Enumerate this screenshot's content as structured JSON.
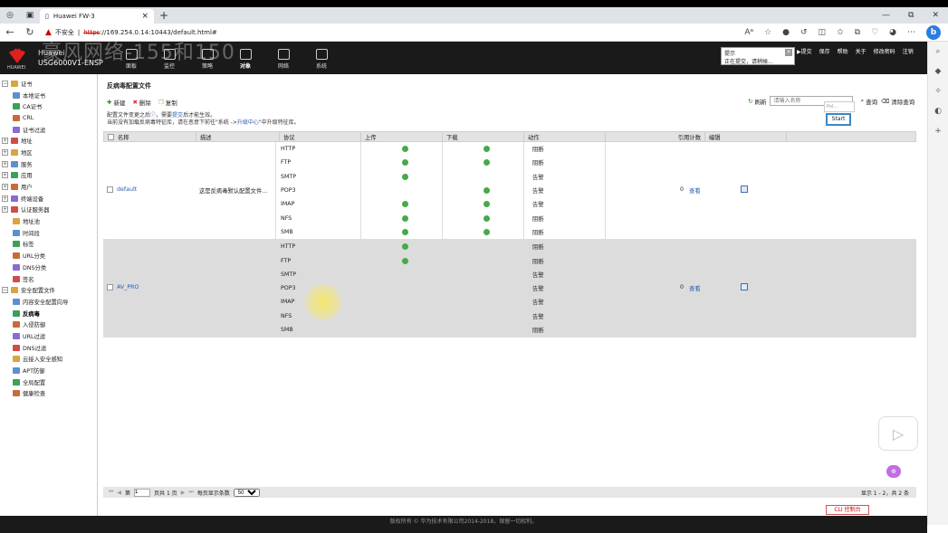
{
  "browser": {
    "tab_title": "Huawei FW-3",
    "insecure_label": "不安全",
    "url_https": "https",
    "url_rest": "://169.254.0.14:10443/default.html#"
  },
  "banner": {
    "brand_small": "HUAWEI",
    "vendor": "Huawei",
    "model": "USG6000V1-ENSP",
    "watermark": "豪风网络-155和150",
    "menu": [
      {
        "label": "面板"
      },
      {
        "label": "监控"
      },
      {
        "label": "策略"
      },
      {
        "label": "对象",
        "active": true
      },
      {
        "label": "网络"
      },
      {
        "label": "系统"
      }
    ],
    "tip_title": "提示",
    "tip_text": "正在提交，请稍候...",
    "links": [
      "▶提交",
      "保存",
      "帮助",
      "关于",
      "修改密码",
      "注销"
    ]
  },
  "sidebar": {
    "items": [
      {
        "label": "证书",
        "level": 0,
        "exp": "−"
      },
      {
        "label": "本地证书",
        "level": 1
      },
      {
        "label": "CA证书",
        "level": 1
      },
      {
        "label": "CRL",
        "level": 1
      },
      {
        "label": "证书过滤",
        "level": 1
      },
      {
        "label": "地址",
        "level": 0,
        "exp": "+"
      },
      {
        "label": "地区",
        "level": 0,
        "exp": "+"
      },
      {
        "label": "服务",
        "level": 0,
        "exp": "+"
      },
      {
        "label": "应用",
        "level": 0,
        "exp": "+"
      },
      {
        "label": "用户",
        "level": 0,
        "exp": "+"
      },
      {
        "label": "终端设备",
        "level": 0,
        "exp": "+"
      },
      {
        "label": "认证服务器",
        "level": 0,
        "exp": "+"
      },
      {
        "label": "地址池",
        "level": 1
      },
      {
        "label": "时间段",
        "level": 1
      },
      {
        "label": "标签",
        "level": 1
      },
      {
        "label": "URL分类",
        "level": 1
      },
      {
        "label": "DNS分类",
        "level": 1
      },
      {
        "label": "签名",
        "level": 1
      },
      {
        "label": "安全配置文件",
        "level": 0,
        "exp": "−"
      },
      {
        "label": "内容安全配置向导",
        "level": 1
      },
      {
        "label": "反病毒",
        "level": 1,
        "selected": true
      },
      {
        "label": "入侵防御",
        "level": 1
      },
      {
        "label": "URL过滤",
        "level": 1
      },
      {
        "label": "DNS过滤",
        "level": 1
      },
      {
        "label": "云接入安全感知",
        "level": 1
      },
      {
        "label": "APT防御",
        "level": 1
      },
      {
        "label": "全局配置",
        "level": 1
      },
      {
        "label": "健康检查",
        "level": 1
      }
    ]
  },
  "content": {
    "title": "反病毒配置文件",
    "toolbar": {
      "new": "新建",
      "delete": "删除",
      "copy": "复制"
    },
    "note_line1_a": "配置文件变更之后",
    "note_line1_b": "，需要",
    "note_line1_link": "提交",
    "note_line1_c": "后才能生效。",
    "note_line2_a": "当前没有加载反病毒特征库，请在恶意",
    "note_line2_b": "下前往\"系统 ->",
    "note_line2_link": "升级中心",
    "note_line2_c": "\"中升级特征库。",
    "refresh": "刷新",
    "search_placeholder": "请输入名称",
    "query": "查询",
    "clear_query": "清除查询",
    "dropdown_hint": "Pol...",
    "start": "Start",
    "columns": [
      "名称",
      "描述",
      "协议",
      "上传",
      "下载",
      "动作",
      "引用计数",
      "编辑"
    ],
    "profiles": [
      {
        "name": "default",
        "desc": "这是反病毒默认配置文件...",
        "refcount": "0",
        "view": "查看",
        "rows": [
          {
            "proto": "HTTP",
            "up": true,
            "down": true,
            "action": "阻断"
          },
          {
            "proto": "FTP",
            "up": true,
            "down": true,
            "action": "阻断"
          },
          {
            "proto": "SMTP",
            "up": true,
            "down": false,
            "action": "告警"
          },
          {
            "proto": "POP3",
            "up": false,
            "down": true,
            "action": "告警"
          },
          {
            "proto": "IMAP",
            "up": true,
            "down": true,
            "action": "告警"
          },
          {
            "proto": "NFS",
            "up": true,
            "down": true,
            "action": "阻断"
          },
          {
            "proto": "SMB",
            "up": true,
            "down": true,
            "action": "阻断"
          }
        ]
      },
      {
        "name": "AV_PRO",
        "desc": "",
        "refcount": "0",
        "view": "查看",
        "rows": [
          {
            "proto": "HTTP",
            "up": true,
            "down": false,
            "action": "阻断"
          },
          {
            "proto": "FTP",
            "up": true,
            "down": false,
            "action": "阻断"
          },
          {
            "proto": "SMTP",
            "up": false,
            "down": false,
            "action": "告警"
          },
          {
            "proto": "POP3",
            "up": false,
            "down": false,
            "action": "告警"
          },
          {
            "proto": "IMAP",
            "up": false,
            "down": false,
            "action": "告警"
          },
          {
            "proto": "NFS",
            "up": false,
            "down": false,
            "action": "告警"
          },
          {
            "proto": "SMB",
            "up": false,
            "down": false,
            "action": "阻断"
          }
        ]
      }
    ],
    "pager": {
      "page_prefix": "第",
      "page_value": "1",
      "page_suffix": "页共 1 页",
      "per_page_label": "每页显示条数",
      "per_page": "50",
      "info": "显示 1 - 2，共 2 条"
    }
  },
  "cli_console": "CLI 控制台",
  "footer": "版权所有 © 华为技术有限公司2014-2018，保留一切权利。",
  "colors": {
    "ok_dot": "#48a84a",
    "link": "#2a5db0",
    "banner": "#1a1a1a"
  }
}
